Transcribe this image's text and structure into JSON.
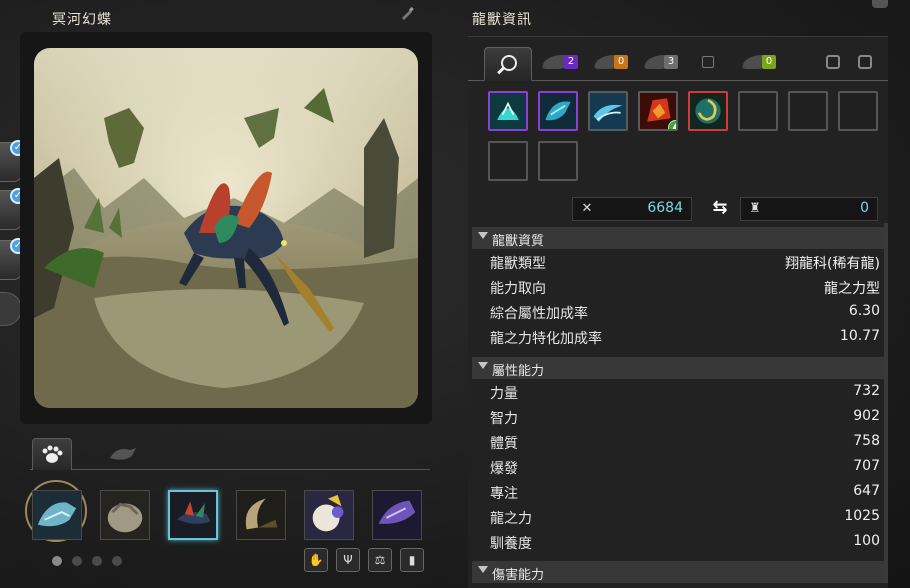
{
  "left_panel": {
    "title": "冥河幻蝶",
    "pet_tabs": [
      {
        "icon": "paw-icon",
        "active": true
      },
      {
        "icon": "dragon-head-icon",
        "active": false
      }
    ],
    "pets": [
      {
        "icon": "ice-dragon-portrait"
      },
      {
        "icon": "rock-turtle-portrait"
      },
      {
        "icon": "butterfly-dragon-portrait",
        "selected": true
      },
      {
        "icon": "beetle-portrait"
      },
      {
        "icon": "snow-beast-portrait"
      },
      {
        "icon": "violet-dragon-portrait"
      }
    ],
    "page_dots": 4,
    "active_dot": 0,
    "action_buttons": [
      "paw-action-icon",
      "wings-action-icon",
      "scales-icon",
      "card-icon"
    ]
  },
  "right_panel": {
    "title": "龍獸資訊",
    "tabs": [
      {
        "icon": "magnifier-icon",
        "active": true
      },
      {
        "icon": "wing-icon",
        "badge": "2",
        "badge_color": "#6a2ac0"
      },
      {
        "icon": "claw-icon",
        "badge": "0",
        "badge_color": "#c8741c"
      },
      {
        "icon": "horn-icon",
        "badge": "3",
        "badge_color": "#6e6e6e"
      },
      {
        "icon": "checkbox-icon"
      },
      {
        "icon": "fang-icon",
        "badge": "0",
        "badge_color": "#79a41c"
      }
    ],
    "skills": [
      {
        "icon": "water-splash-skill-icon",
        "border": "purple"
      },
      {
        "icon": "dragon-roar-skill-icon",
        "border": "purple"
      },
      {
        "icon": "wind-wave-skill-icon",
        "border": "gray"
      },
      {
        "icon": "fire-gem-skill-icon",
        "border": "gray",
        "upgrade": true
      },
      {
        "icon": "spiral-orb-skill-icon",
        "border": "red"
      },
      {
        "icon": "empty-skill-slot",
        "border": "empty"
      },
      {
        "icon": "empty-skill-slot",
        "border": "empty"
      },
      {
        "icon": "empty-skill-slot",
        "border": "empty"
      },
      {
        "icon": "empty-skill-slot",
        "border": "empty"
      },
      {
        "icon": "empty-skill-slot",
        "border": "empty"
      }
    ],
    "combat_power": "6684",
    "defense_power": "0",
    "sections": [
      {
        "label": "龍獸資質",
        "rows": [
          {
            "key": "龍獸類型",
            "value": "翔龍科(稀有龍)"
          },
          {
            "key": "能力取向",
            "value": "龍之力型"
          },
          {
            "key": "綜合屬性加成率",
            "value": "6.30"
          },
          {
            "key": "龍之力特化加成率",
            "value": "10.77"
          }
        ]
      },
      {
        "label": "屬性能力",
        "rows": [
          {
            "key": "力量",
            "value": "732"
          },
          {
            "key": "智力",
            "value": "902"
          },
          {
            "key": "體質",
            "value": "758"
          },
          {
            "key": "爆發",
            "value": "707"
          },
          {
            "key": "專注",
            "value": "647"
          },
          {
            "key": "龍之力",
            "value": "1025"
          },
          {
            "key": "馴養度",
            "value": "100"
          }
        ]
      },
      {
        "label": "傷害能力",
        "rows": []
      }
    ]
  }
}
